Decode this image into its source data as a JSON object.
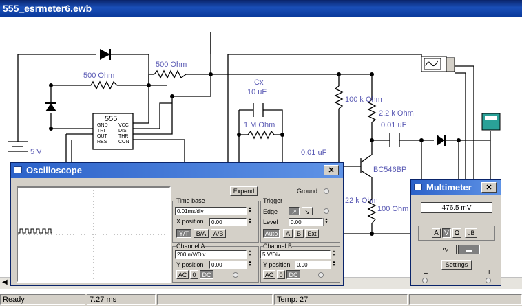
{
  "window": {
    "title": "555_esrmeter6.ewb"
  },
  "circuit": {
    "labels": {
      "r1": "500  Ohm",
      "r2": "500  Ohm",
      "cx": "Cx",
      "cx_val": "10 uF",
      "r_1m": "1 M Ohm",
      "r_100k": "100 k Ohm",
      "r_2k2": "2.2 k Ohm",
      "c_001a": "0.01 uF",
      "c_001b": "0.01 uF",
      "ic": "555",
      "pin_gnd": "GND",
      "pin_tri": "TRI",
      "pin_out": "OUT",
      "pin_res": "RES",
      "pin_vcc": "VCC",
      "pin_dis": "DIS",
      "pin_thr": "THR",
      "pin_con": "CON",
      "battery": "5 V",
      "transistor": "BC546BP",
      "r_22k": "22 k Ohm",
      "r_100": "100  Ohm"
    }
  },
  "oscilloscope": {
    "title": "Oscilloscope",
    "expand": "Expand",
    "ground": "Ground",
    "timebase": {
      "heading": "Time base",
      "value": "0.01ms/div",
      "xpos_label": "X position",
      "xpos_value": "0.00",
      "modes": [
        "Y/T",
        "B/A",
        "A/B"
      ]
    },
    "trigger": {
      "heading": "Trigger",
      "edge_label": "Edge",
      "level_label": "Level",
      "level_value": "0.00",
      "modes": [
        "Auto",
        "A",
        "B",
        "Ext"
      ]
    },
    "channel_a": {
      "heading": "Channel A",
      "value": "200 mV/Div",
      "ypos_label": "Y position",
      "ypos_value": "0.00",
      "coupling": [
        "AC",
        "0",
        "DC"
      ]
    },
    "channel_b": {
      "heading": "Channel B",
      "value": "5  V/Div",
      "ypos_label": "Y position",
      "ypos_value": "0.00",
      "coupling": [
        "AC",
        "0",
        "DC"
      ]
    }
  },
  "multimeter": {
    "title": "Multimeter",
    "reading": "476.5   mV",
    "modes": [
      "A",
      "V",
      "Ω",
      "dB"
    ],
    "settings": "Settings",
    "minus": "−",
    "plus": "+"
  },
  "status": {
    "state": "Ready",
    "time": "7.27 ms",
    "temp": "Temp:  27"
  },
  "colors": {
    "accent_title": "#0a246a",
    "wire": "#000000",
    "label": "#5a5ab4"
  }
}
